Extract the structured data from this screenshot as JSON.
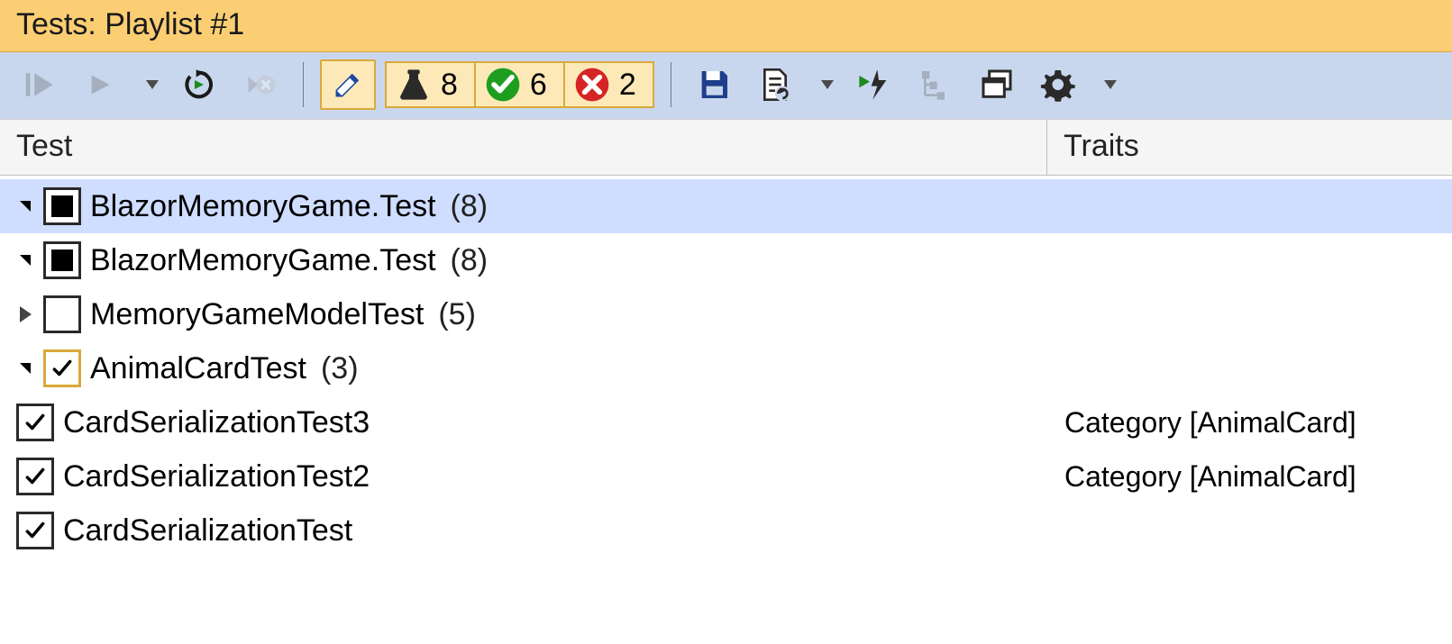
{
  "title": "Tests: Playlist #1",
  "columns": {
    "test": "Test",
    "traits": "Traits"
  },
  "counters": {
    "total": "8",
    "passed": "6",
    "failed": "2"
  },
  "tree": {
    "root": {
      "name": "BlazorMemoryGame.Test",
      "count": "(8)"
    },
    "ns": {
      "name": "BlazorMemoryGame.Test",
      "count": "(8)"
    },
    "class1": {
      "name": "MemoryGameModelTest",
      "count": "(5)"
    },
    "class2": {
      "name": "AnimalCardTest",
      "count": "(3)"
    },
    "t1": {
      "name": "CardSerializationTest3",
      "trait": "Category [AnimalCard]"
    },
    "t2": {
      "name": "CardSerializationTest2",
      "trait": "Category [AnimalCard]"
    },
    "t3": {
      "name": "CardSerializationTest",
      "trait": ""
    }
  }
}
